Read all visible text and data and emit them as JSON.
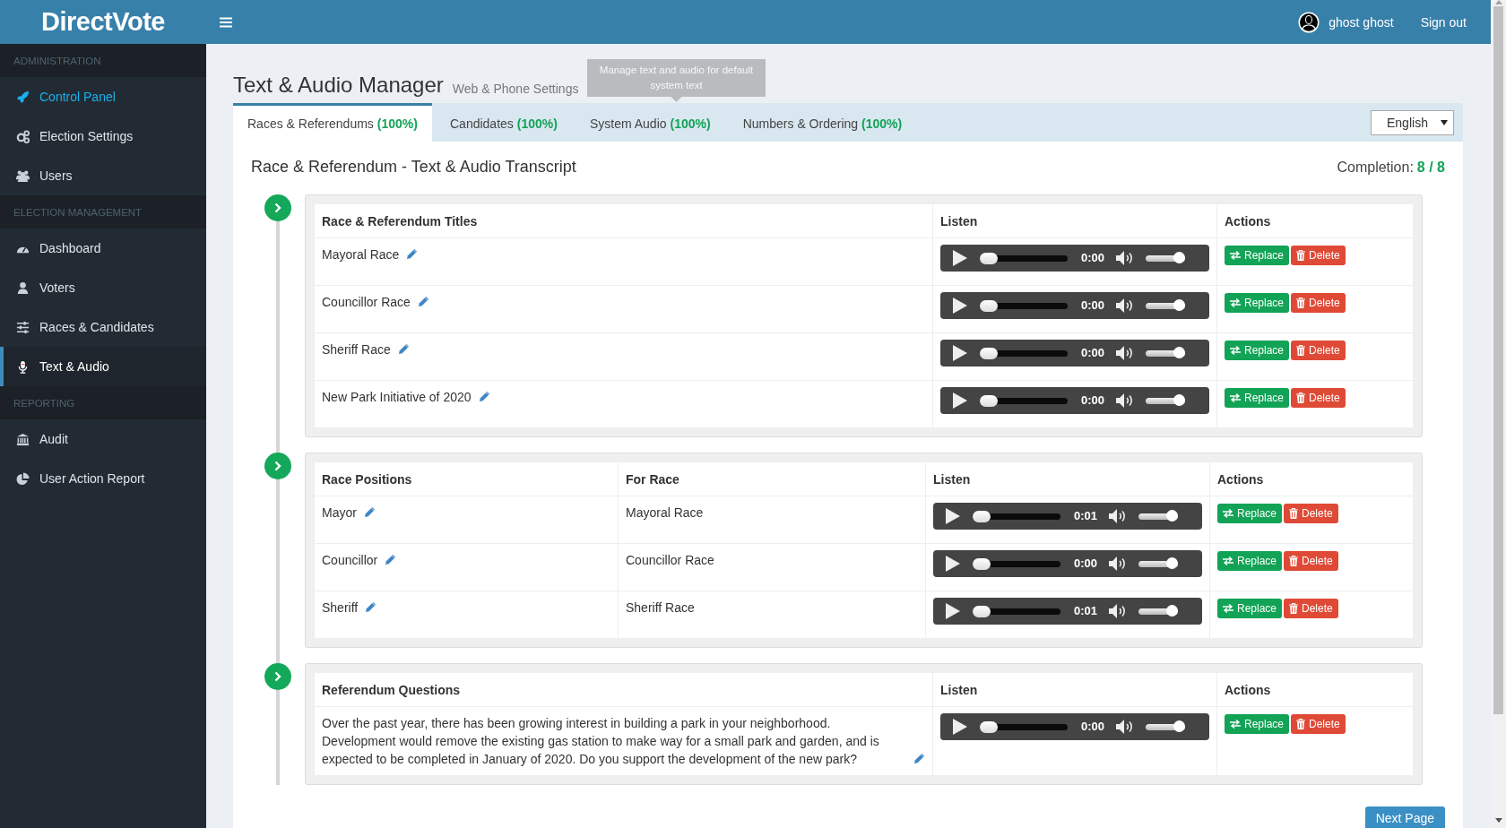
{
  "topbar": {
    "logo": "DirectVote",
    "user": "ghost ghost",
    "sign_out": "Sign out"
  },
  "sidebar": [
    {
      "title": "ADMINISTRATION",
      "items": [
        {
          "label": "Control Panel",
          "kind": "rocket",
          "accent": true,
          "selected": false
        },
        {
          "label": "Election Settings",
          "kind": "gears",
          "accent": false,
          "selected": false
        },
        {
          "label": "Users",
          "kind": "users",
          "accent": false,
          "selected": false
        }
      ]
    },
    {
      "title": "ELECTION MANAGEMENT",
      "items": [
        {
          "label": "Dashboard",
          "kind": "gauge",
          "accent": false,
          "selected": false
        },
        {
          "label": "Voters",
          "kind": "user",
          "accent": false,
          "selected": false
        },
        {
          "label": "Races & Candidates",
          "kind": "sliders",
          "accent": false,
          "selected": false
        },
        {
          "label": "Text & Audio",
          "kind": "mic",
          "accent": false,
          "selected": true
        }
      ]
    },
    {
      "title": "REPORTING",
      "items": [
        {
          "label": "Audit",
          "kind": "bank",
          "accent": false,
          "selected": false
        },
        {
          "label": "User Action Report",
          "kind": "pie",
          "accent": false,
          "selected": false
        }
      ]
    }
  ],
  "page": {
    "title": "Text & Audio Manager",
    "subtitle": "Web & Phone Settings",
    "tooltip": "Manage text and audio for default system text"
  },
  "tabs": [
    {
      "label": "Races & Referendums",
      "percent": "(100%)",
      "selected": true
    },
    {
      "label": "Candidates",
      "percent": "(100%)",
      "selected": false
    },
    {
      "label": "System Audio",
      "percent": "(100%)",
      "selected": false
    },
    {
      "label": "Numbers & Ordering",
      "percent": "(100%)",
      "selected": false
    }
  ],
  "language_select": {
    "value": "English"
  },
  "transcript": {
    "title": "Race & Referendum - Text & Audio Transcript",
    "completion_label": "Completion:",
    "completion_value": "8 / 8"
  },
  "sections": [
    {
      "columns": [
        "Race & Referendum Titles",
        "Listen",
        "Actions"
      ],
      "rows": [
        {
          "cells": [
            "Mayoral Race"
          ],
          "player": {
            "time": "0:00",
            "position": {
              "level": 0
            },
            "volume": {
              "level": 1
            }
          },
          "actions": [
            {
              "label": "Replace",
              "kind": "replace"
            },
            {
              "label": "Delete",
              "kind": "delete"
            }
          ]
        },
        {
          "cells": [
            "Councillor Race"
          ],
          "player": {
            "time": "0:00",
            "position": {
              "level": 0
            },
            "volume": {
              "level": 1
            }
          },
          "actions": [
            {
              "label": "Replace",
              "kind": "replace"
            },
            {
              "label": "Delete",
              "kind": "delete"
            }
          ]
        },
        {
          "cells": [
            "Sheriff Race"
          ],
          "player": {
            "time": "0:00",
            "position": {
              "level": 0
            },
            "volume": {
              "level": 1
            }
          },
          "actions": [
            {
              "label": "Replace",
              "kind": "replace"
            },
            {
              "label": "Delete",
              "kind": "delete"
            }
          ]
        },
        {
          "cells": [
            "New Park Initiative of 2020"
          ],
          "player": {
            "time": "0:00",
            "position": {
              "level": 0
            },
            "volume": {
              "level": 1
            }
          },
          "actions": [
            {
              "label": "Replace",
              "kind": "replace"
            },
            {
              "label": "Delete",
              "kind": "delete"
            }
          ]
        }
      ]
    },
    {
      "columns": [
        "Race Positions",
        "For Race",
        "Listen",
        "Actions"
      ],
      "rows": [
        {
          "cells": [
            "Mayor",
            "Mayoral Race"
          ],
          "player": {
            "time": "0:01",
            "position": {
              "level": 0
            },
            "volume": {
              "level": 1
            }
          },
          "actions": [
            {
              "label": "Replace",
              "kind": "replace"
            },
            {
              "label": "Delete",
              "kind": "delete"
            }
          ]
        },
        {
          "cells": [
            "Councillor",
            "Councillor Race"
          ],
          "player": {
            "time": "0:00",
            "position": {
              "level": 0
            },
            "volume": {
              "level": 1
            }
          },
          "actions": [
            {
              "label": "Replace",
              "kind": "replace"
            },
            {
              "label": "Delete",
              "kind": "delete"
            }
          ]
        },
        {
          "cells": [
            "Sheriff",
            "Sheriff Race"
          ],
          "player": {
            "time": "0:01",
            "position": {
              "level": 0
            },
            "volume": {
              "level": 1
            }
          },
          "actions": [
            {
              "label": "Replace",
              "kind": "replace"
            },
            {
              "label": "Delete",
              "kind": "delete"
            }
          ]
        }
      ]
    },
    {
      "columns": [
        "Referendum Questions",
        "Listen",
        "Actions"
      ],
      "rows": [
        {
          "cells": [
            "Over the past year, there has been growing interest in building a park in your neighborhood. Development would remove the existing gas station to make way for a small park and garden, and is expected to be completed in January of 2020. Do you support the development of the new park?"
          ],
          "player": {
            "time": "0:00",
            "position": {
              "level": 0
            },
            "volume": {
              "level": 1
            }
          },
          "actions": [
            {
              "label": "Replace",
              "kind": "replace"
            },
            {
              "label": "Delete",
              "kind": "delete"
            }
          ]
        }
      ]
    }
  ],
  "next_button": "Next Page"
}
